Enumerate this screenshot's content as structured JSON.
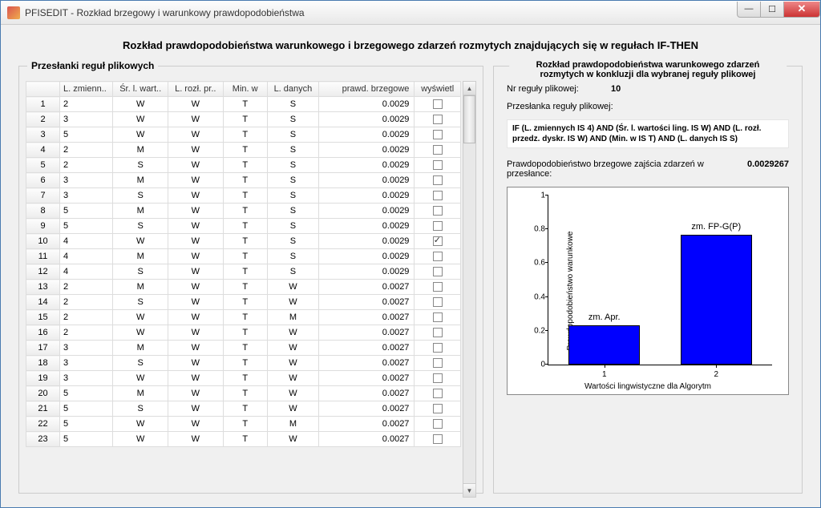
{
  "window": {
    "title": "PFISEDIT - Rozkład brzegowy i warunkowy prawdopodobieństwa"
  },
  "main_title": "Rozkład prawdopodobieństwa warunkowego i brzegowego zdarzeń rozmytych znajdujących się w regułach IF-THEN",
  "left": {
    "title": "Przesłanki reguł plikowych",
    "columns": [
      "L. zmienn..",
      "Śr. l. wart..",
      "L. rozł. pr..",
      "Min. w",
      "L. danych",
      "prawd. brzegowe",
      "wyświetl"
    ],
    "rows": [
      {
        "n": 1,
        "c": [
          "2",
          "W",
          "W",
          "T",
          "S",
          "0.0029"
        ],
        "chk": false
      },
      {
        "n": 2,
        "c": [
          "3",
          "W",
          "W",
          "T",
          "S",
          "0.0029"
        ],
        "chk": false
      },
      {
        "n": 3,
        "c": [
          "5",
          "W",
          "W",
          "T",
          "S",
          "0.0029"
        ],
        "chk": false
      },
      {
        "n": 4,
        "c": [
          "2",
          "M",
          "W",
          "T",
          "S",
          "0.0029"
        ],
        "chk": false
      },
      {
        "n": 5,
        "c": [
          "2",
          "S",
          "W",
          "T",
          "S",
          "0.0029"
        ],
        "chk": false
      },
      {
        "n": 6,
        "c": [
          "3",
          "M",
          "W",
          "T",
          "S",
          "0.0029"
        ],
        "chk": false
      },
      {
        "n": 7,
        "c": [
          "3",
          "S",
          "W",
          "T",
          "S",
          "0.0029"
        ],
        "chk": false
      },
      {
        "n": 8,
        "c": [
          "5",
          "M",
          "W",
          "T",
          "S",
          "0.0029"
        ],
        "chk": false
      },
      {
        "n": 9,
        "c": [
          "5",
          "S",
          "W",
          "T",
          "S",
          "0.0029"
        ],
        "chk": false
      },
      {
        "n": 10,
        "c": [
          "4",
          "W",
          "W",
          "T",
          "S",
          "0.0029"
        ],
        "chk": true
      },
      {
        "n": 11,
        "c": [
          "4",
          "M",
          "W",
          "T",
          "S",
          "0.0029"
        ],
        "chk": false
      },
      {
        "n": 12,
        "c": [
          "4",
          "S",
          "W",
          "T",
          "S",
          "0.0029"
        ],
        "chk": false
      },
      {
        "n": 13,
        "c": [
          "2",
          "M",
          "W",
          "T",
          "W",
          "0.0027"
        ],
        "chk": false
      },
      {
        "n": 14,
        "c": [
          "2",
          "S",
          "W",
          "T",
          "W",
          "0.0027"
        ],
        "chk": false
      },
      {
        "n": 15,
        "c": [
          "2",
          "W",
          "W",
          "T",
          "M",
          "0.0027"
        ],
        "chk": false
      },
      {
        "n": 16,
        "c": [
          "2",
          "W",
          "W",
          "T",
          "W",
          "0.0027"
        ],
        "chk": false
      },
      {
        "n": 17,
        "c": [
          "3",
          "M",
          "W",
          "T",
          "W",
          "0.0027"
        ],
        "chk": false
      },
      {
        "n": 18,
        "c": [
          "3",
          "S",
          "W",
          "T",
          "W",
          "0.0027"
        ],
        "chk": false
      },
      {
        "n": 19,
        "c": [
          "3",
          "W",
          "W",
          "T",
          "W",
          "0.0027"
        ],
        "chk": false
      },
      {
        "n": 20,
        "c": [
          "5",
          "M",
          "W",
          "T",
          "W",
          "0.0027"
        ],
        "chk": false
      },
      {
        "n": 21,
        "c": [
          "5",
          "S",
          "W",
          "T",
          "W",
          "0.0027"
        ],
        "chk": false
      },
      {
        "n": 22,
        "c": [
          "5",
          "W",
          "W",
          "T",
          "M",
          "0.0027"
        ],
        "chk": false
      },
      {
        "n": 23,
        "c": [
          "5",
          "W",
          "W",
          "T",
          "W",
          "0.0027"
        ],
        "chk": false
      }
    ]
  },
  "right": {
    "title": "Rozkład prawdopodobieństwa warunkowego zdarzeń rozmytych w konkluzji dla wybranej reguły plikowej",
    "rule_label": "Nr reguły plikowej:",
    "rule_no": "10",
    "premise_label": "Przesłanka reguły plikowej:",
    "premise_text": "IF (L. zmiennych IS 4) AND (Śr. l. wartości ling. IS W) AND (L. rozł. przedz. dyskr. IS W) AND (Min. w IS T) AND (L. danych IS S)",
    "prob_label": "Prawdopodobieństwo brzegowe zajścia zdarzeń w przesłance:",
    "prob_value": "0.0029267"
  },
  "chart_data": {
    "type": "bar",
    "categories": [
      "1",
      "2"
    ],
    "values": [
      0.23,
      0.77
    ],
    "bar_labels": [
      "zm. Apr.",
      "zm. FP-G(P)"
    ],
    "ylabel": "Prawdopodobieństwo warunkowe",
    "xlabel": "Wartości lingwistyczne dla Algorytm",
    "ylim": [
      0,
      1
    ],
    "yticks": [
      0,
      0.2,
      0.4,
      0.6,
      0.8,
      1
    ]
  }
}
